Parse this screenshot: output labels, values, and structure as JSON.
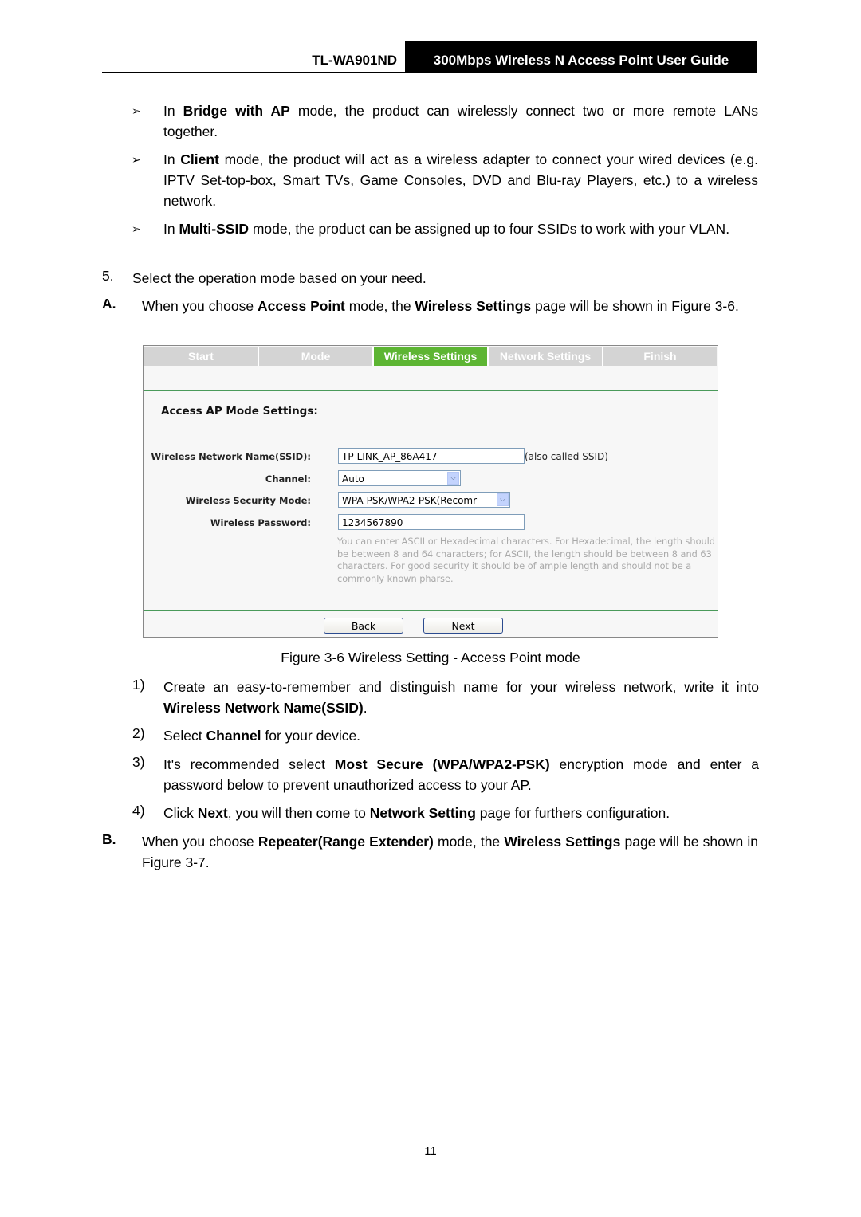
{
  "header": {
    "model": "TL-WA901ND",
    "title": "300Mbps Wireless N Access Point User Guide"
  },
  "bullets": [
    {
      "prefix": "In ",
      "bold": "Bridge with AP",
      "rest": " mode, the product can wirelessly connect two or more remote LANs together."
    },
    {
      "prefix": "In ",
      "bold": "Client",
      "rest": " mode, the product will act as a wireless adapter to connect your wired devices (e.g. IPTV Set-top-box, Smart TVs, Game Consoles, DVD and Blu-ray Players, etc.) to a wireless network."
    },
    {
      "prefix": "In ",
      "bold": "Multi-SSID",
      "rest": " mode, the product can be assigned up to four SSIDs to work with your VLAN."
    }
  ],
  "step5": {
    "marker": "5.",
    "text": "Select the operation mode based on your need."
  },
  "stepA": {
    "marker": "A.",
    "t1": "When you choose ",
    "b1": "Access Point",
    "t2": " mode, the ",
    "b2": "Wireless Settings",
    "t3": " page will be shown in Figure 3-6."
  },
  "figure": {
    "tabs": [
      "Start",
      "Mode",
      "Wireless Settings",
      "Network Settings",
      "Finish"
    ],
    "active_tab": "Wireless Settings",
    "section_title": "Access AP Mode Settings:",
    "fields": {
      "ssid_label": "Wireless Network Name(SSID):",
      "ssid_value": "TP-LINK_AP_86A417",
      "ssid_note": "(also called SSID)",
      "channel_label": "Channel:",
      "channel_value": "Auto",
      "security_label": "Wireless Security Mode:",
      "security_value": "WPA-PSK/WPA2-PSK(Recomr",
      "password_label": "Wireless Password:",
      "password_value": "1234567890"
    },
    "hint": "You can enter ASCII or Hexadecimal characters. For Hexadecimal, the length should be between 8 and 64 characters; for ASCII, the length should be between 8 and 63 characters. For good security it should be of ample length and should not be a commonly known pharse.",
    "buttons": {
      "back": "Back",
      "next": "Next"
    },
    "colors": {
      "active_tab": "#5db533",
      "inactive_tab": "#d4d4d4",
      "divider": "#4a9a5a"
    }
  },
  "caption": "Figure 3-6 Wireless Setting - Access Point mode",
  "numbered": [
    {
      "marker": "1)",
      "t1": "Create an easy-to-remember and distinguish name for your wireless network, write it into ",
      "b1": "Wireless Network Name(SSID)",
      "t2": "."
    },
    {
      "marker": "2)",
      "t1": "Select ",
      "b1": "Channel",
      "t2": " for your device."
    },
    {
      "marker": "3)",
      "t1": "It's recommended select ",
      "b1": "Most Secure (WPA/WPA2-PSK)",
      "t2": " encryption mode and enter a password below to prevent unauthorized access to your AP."
    },
    {
      "marker": "4)",
      "t1": "Click ",
      "b1": "Next",
      "t2": ", you will then come to ",
      "b2": "Network Setting",
      "t3": " page for furthers configuration."
    }
  ],
  "stepB": {
    "marker": "B.",
    "t1": "When you choose ",
    "b1": "Repeater(Range Extender)",
    "t2": " mode, the ",
    "b2": "Wireless Settings",
    "t3": " page will be shown in Figure 3-7."
  },
  "page_number": "11"
}
